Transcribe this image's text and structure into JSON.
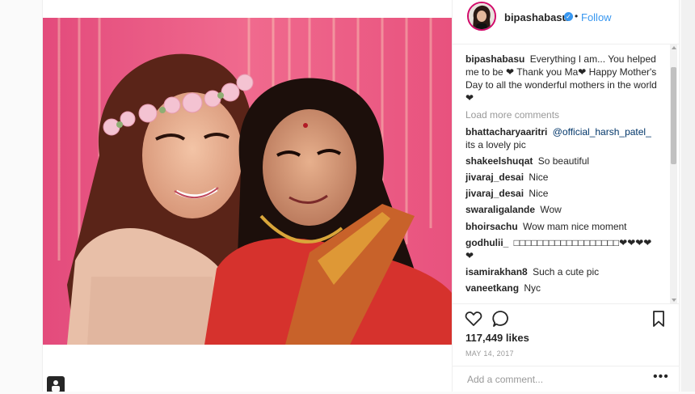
{
  "post": {
    "username": "bipashabasu",
    "follow_label": "Follow",
    "dot": "•",
    "verified_mark": "✓",
    "caption": {
      "user": "bipashabasu",
      "text": "Everything I am... You helped me to be ❤ Thank you Ma❤ Happy Mother's Day to all the wonderful mothers in the world❤"
    },
    "load_more_label": "Load more comments",
    "comments": [
      {
        "user": "bhattacharyaaritri",
        "mention": "@official_harsh_patel_",
        "text": "its a lovely pic"
      },
      {
        "user": "shakeelshuqat",
        "text": "So beautiful"
      },
      {
        "user": "jivaraj_desai",
        "text": "Nice"
      },
      {
        "user": "jivaraj_desai",
        "text": "Nice"
      },
      {
        "user": "swaraligalande",
        "text": "Wow"
      },
      {
        "user": "bhoirsachu",
        "text": "Wow mam nice moment"
      },
      {
        "user": "godhulii_",
        "text": "□□□□□□□□□□□□□□□□□□❤❤❤❤❤"
      },
      {
        "user": "isamirakhan8",
        "text": "Such a cute pic"
      },
      {
        "user": "vaneetkang",
        "text": "Nyc"
      }
    ],
    "likes_label": "117,449 likes",
    "date_label": "MAY 14, 2017",
    "add_comment_placeholder": "Add a comment...",
    "more_label": "•••"
  },
  "colors": {
    "accent": "#3897f0",
    "border": "#efefef",
    "muted": "#999999",
    "text": "#262626"
  },
  "icons": [
    "verified-badge-icon",
    "heart-icon",
    "comment-icon",
    "bookmark-icon",
    "more-options-icon",
    "camera-icon"
  ]
}
